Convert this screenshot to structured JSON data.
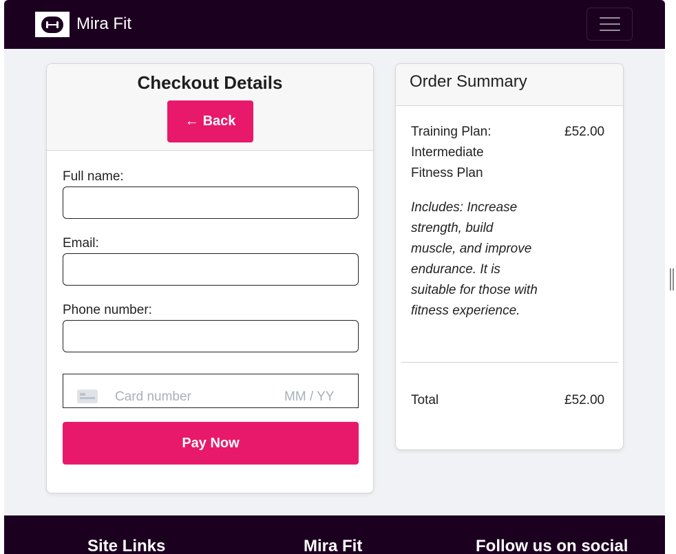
{
  "navbar": {
    "brand_name": "Mira Fit",
    "logo_icon": "dumbbell-icon",
    "menu_icon": "hamburger-icon",
    "background": "#1c0020"
  },
  "checkout": {
    "title": "Checkout Details",
    "back_arrow": "←",
    "back_label": "Back",
    "fields": [
      {
        "label": "Full name:",
        "value": ""
      },
      {
        "label": "Email:",
        "value": ""
      },
      {
        "label": "Phone number:",
        "value": ""
      }
    ],
    "card": {
      "icon": "credit-card-icon",
      "number_placeholder": "Card number",
      "expiry_placeholder": "MM / YY"
    },
    "pay_label": "Pay Now",
    "accent": "#e8196a"
  },
  "summary": {
    "title": "Order Summary",
    "plan_name": "Training Plan: Intermediate Fitness Plan",
    "plan_price": "£52.00",
    "plan_description": "Includes: Increase strength, build muscle, and improve endurance. It is suitable for those with fitness experience.",
    "total_label": "Total",
    "total_value": "£52.00"
  },
  "footer": {
    "headings": [
      "Site Links",
      "Mira Fit",
      "Follow us on social"
    ]
  }
}
